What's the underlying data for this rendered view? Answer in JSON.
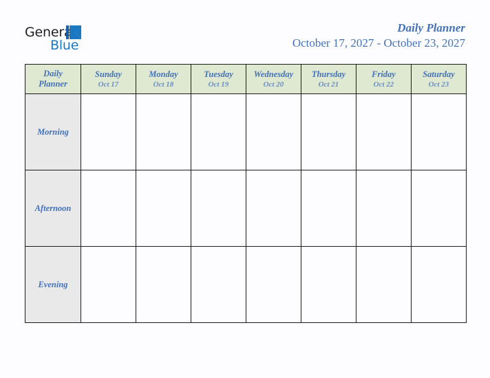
{
  "brand": {
    "name_part1": "General",
    "name_part2": "Blue",
    "mark": "triangle-logo-icon",
    "colors": {
      "dark": "#231f20",
      "blue": "#1a78c2"
    }
  },
  "header": {
    "title": "Daily Planner",
    "date_range": "October 17, 2027 - October 23, 2027",
    "accent_color": "#4472b8"
  },
  "table": {
    "corner": {
      "line1": "Daily",
      "line2": "Planner"
    },
    "header_background": "#dfe8d1",
    "label_background": "#e9e9e9",
    "border_color": "#1b1b1b",
    "days": [
      {
        "name": "Sunday",
        "date": "Oct 17"
      },
      {
        "name": "Monday",
        "date": "Oct 18"
      },
      {
        "name": "Tuesday",
        "date": "Oct 19"
      },
      {
        "name": "Wednesday",
        "date": "Oct 20"
      },
      {
        "name": "Thursday",
        "date": "Oct 21"
      },
      {
        "name": "Friday",
        "date": "Oct 22"
      },
      {
        "name": "Saturday",
        "date": "Oct 23"
      }
    ],
    "slots": [
      {
        "label": "Morning",
        "entries": [
          "",
          "",
          "",
          "",
          "",
          "",
          ""
        ]
      },
      {
        "label": "Afternoon",
        "entries": [
          "",
          "",
          "",
          "",
          "",
          "",
          ""
        ]
      },
      {
        "label": "Evening",
        "entries": [
          "",
          "",
          "",
          "",
          "",
          "",
          ""
        ]
      }
    ]
  }
}
